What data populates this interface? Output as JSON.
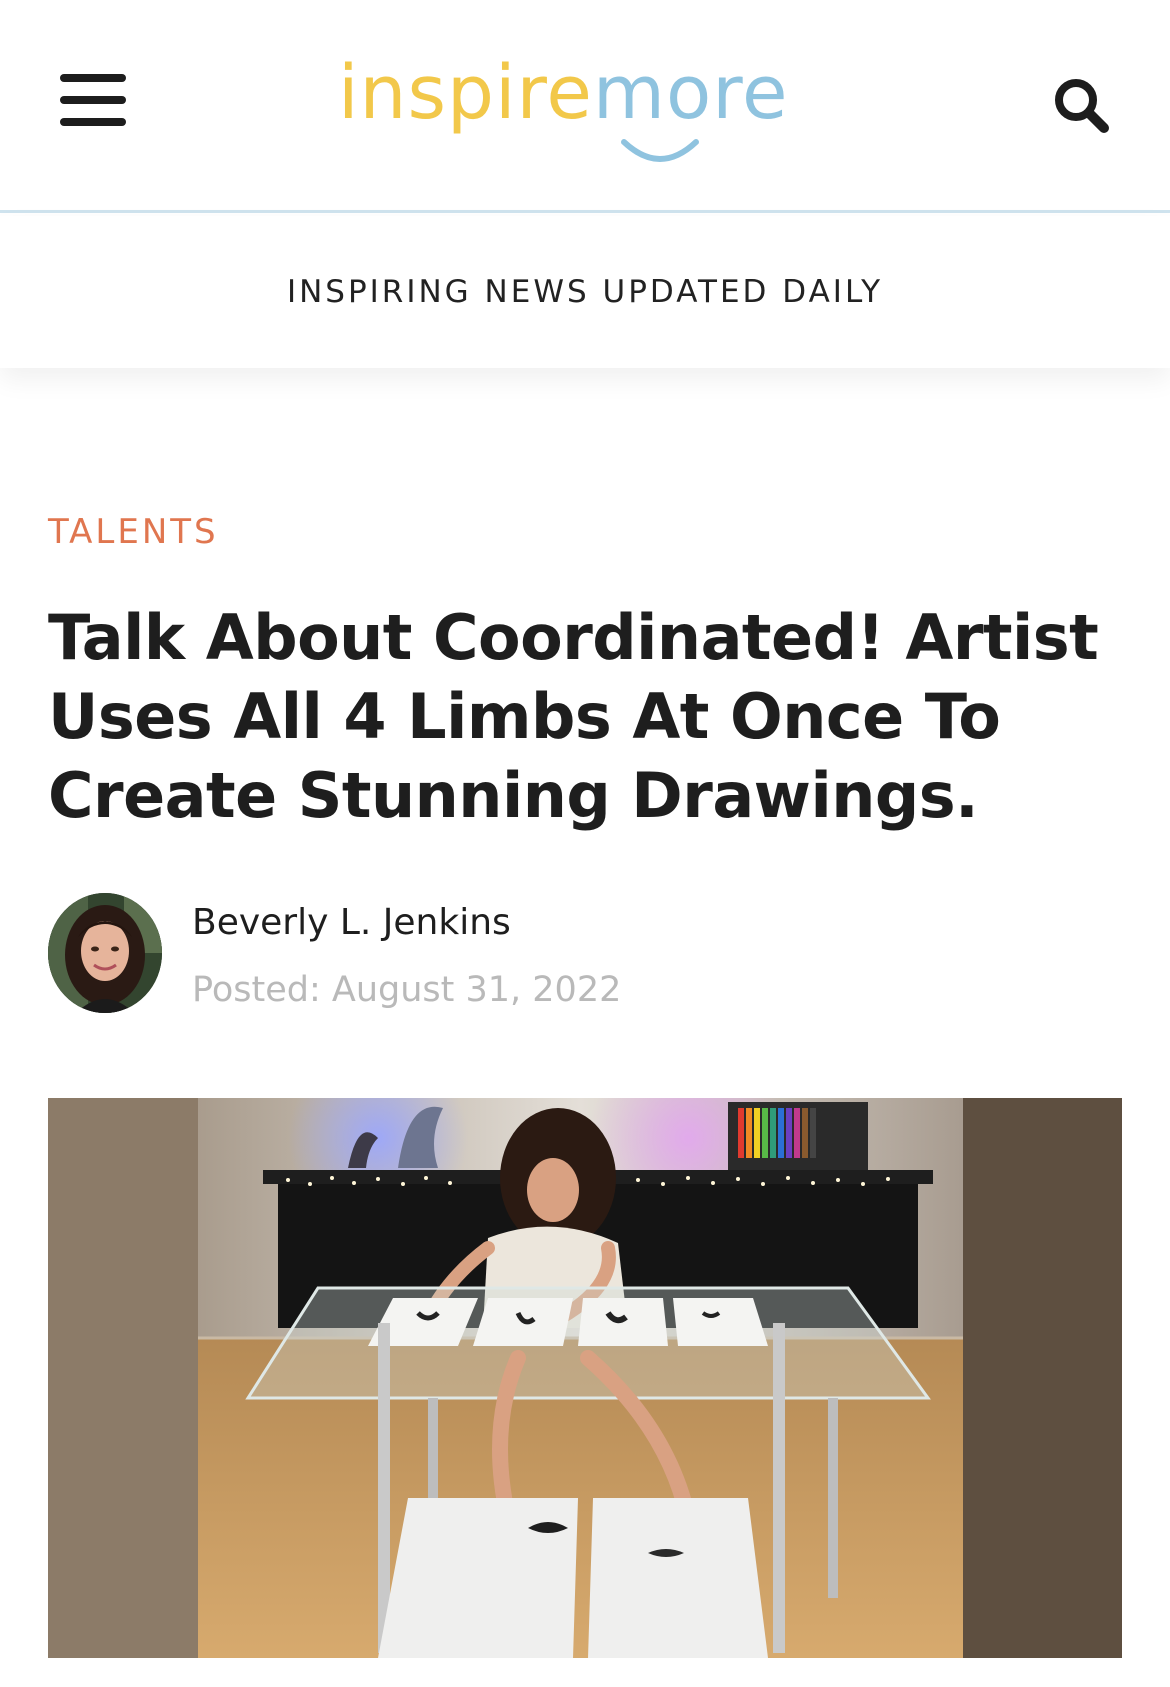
{
  "header": {
    "logo_part1": "inspire",
    "logo_part2": "more",
    "menu_icon": "hamburger-menu-icon",
    "search_icon": "search-icon"
  },
  "tagline": "INSPIRING NEWS UPDATED DAILY",
  "article": {
    "category": "TALENTS",
    "title": "Talk About Coordinated! Artist Uses All 4 Limbs At Once To Create Stunning Drawings.",
    "author": "Beverly L. Jenkins",
    "posted": "Posted: August 31, 2022"
  },
  "colors": {
    "logo_yellow": "#f2c84a",
    "logo_blue": "#8fc3df",
    "category": "#e0764f",
    "muted_text": "#b9b9b9"
  }
}
